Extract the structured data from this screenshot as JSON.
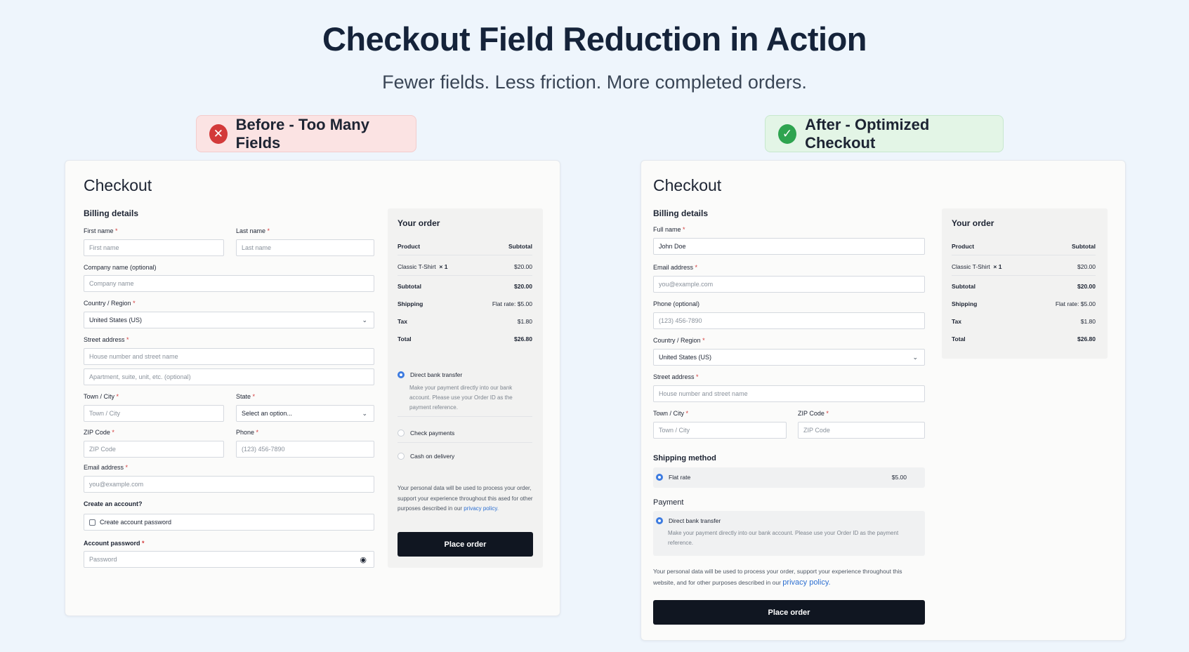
{
  "header": {
    "title": "Checkout Field Reduction in Action",
    "subtitle": "Fewer fields. Less friction. More completed orders."
  },
  "before": {
    "badge": "Before - Too Many Fields",
    "badge_icon": "x-circle-icon",
    "badge_color": "#d33a3a",
    "checkout_title": "Checkout",
    "billing_title": "Billing details",
    "fields": {
      "first_name_label": "First name",
      "first_name_placeholder": "First name",
      "last_name_label": "Last name",
      "last_name_placeholder": "Last name",
      "company_label": "Company name (optional)",
      "company_placeholder": "Company name",
      "country_label": "Country / Region",
      "country_value": "United States (US)",
      "street_label": "Street address",
      "street_placeholder": "House number and street name",
      "street2_placeholder": "Apartment, suite, unit, etc. (optional)",
      "city_label": "Town / City",
      "city_placeholder": "Town / City",
      "state_label": "State",
      "state_value": "Select an option...",
      "zip_label": "ZIP Code",
      "zip_placeholder": "ZIP Code",
      "phone_label": "Phone",
      "phone_placeholder": "(123) 456-7890",
      "email_label": "Email address",
      "email_placeholder": "you@example.com",
      "create_account_label": "Create an account?",
      "create_account_checkbox": "Create account password",
      "password_label": "Account password",
      "password_placeholder": "Password"
    },
    "order": {
      "title": "Your order",
      "col_product": "Product",
      "col_subtotal": "Subtotal",
      "item_name": "Classic T-Shirt",
      "item_qty": "× 1",
      "item_price": "$20.00",
      "subtotal_label": "Subtotal",
      "subtotal_value": "$20.00",
      "shipping_label": "Shipping",
      "shipping_value": "Flat rate: $5.00",
      "tax_label": "Tax",
      "tax_value": "$1.80",
      "total_label": "Total",
      "total_value": "$26.80"
    },
    "payment": {
      "bank": "Direct bank transfer",
      "bank_desc": "Make your payment directly into our bank account. Please use your Order ID as the payment reference.",
      "check": "Check payments",
      "cod": "Cash on delivery"
    },
    "privacy_text": "Your personal data will be used to process your order, support your experience throughout this ased for other purposes described in our",
    "privacy_link": "privacy policy.",
    "place_order": "Place order"
  },
  "after": {
    "badge": "After - Optimized Checkout",
    "badge_icon": "check-circle-icon",
    "badge_color": "#2ea44f",
    "checkout_title": "Checkout",
    "billing_title": "Billing details",
    "fields": {
      "full_name_label": "Full name",
      "full_name_value": "John Doe",
      "email_label": "Email address",
      "email_placeholder": "you@example.com",
      "phone_label": "Phone (optional)",
      "phone_placeholder": "(123) 456-7890",
      "country_label": "Country / Region",
      "country_value": "United States (US)",
      "street_label": "Street address",
      "street_placeholder": "House number and street name",
      "city_label": "Town / City",
      "city_placeholder": "Town / City",
      "zip_label": "ZIP Code",
      "zip_placeholder": "ZIP Code"
    },
    "shipping": {
      "title": "Shipping method",
      "option": "Flat rate",
      "price": "$5.00"
    },
    "payment": {
      "title": "Payment",
      "bank": "Direct bank transfer",
      "bank_desc": "Make your payment directly into our bank account. Please use your Order ID as the payment reference."
    },
    "privacy_text": "Your personal data will be used to process your order, support your experience throughout this website, and for other purposes described in our",
    "privacy_link": "privacy policy.",
    "place_order": "Place order",
    "order": {
      "title": "Your order",
      "col_product": "Product",
      "col_subtotal": "Subtotal",
      "item_name": "Classic T-Shirt",
      "item_qty": "× 1",
      "item_price": "$20.00",
      "subtotal_label": "Subtotal",
      "subtotal_value": "$20.00",
      "shipping_label": "Shipping",
      "shipping_value": "Flat rate: $5.00",
      "tax_label": "Tax",
      "tax_value": "$1.80",
      "total_label": "Total",
      "total_value": "$26.80"
    }
  }
}
